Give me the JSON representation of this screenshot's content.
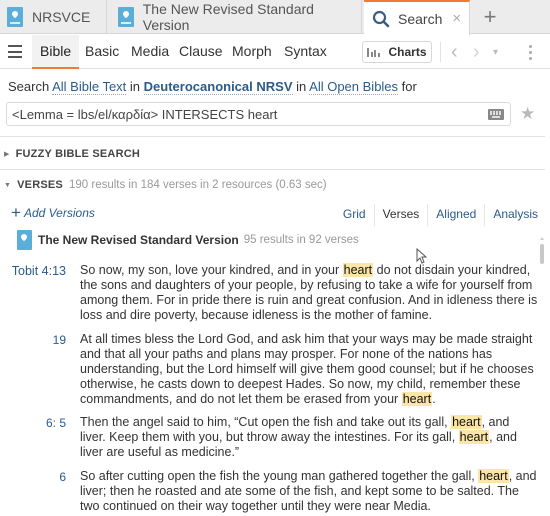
{
  "tabs": [
    {
      "label": "NRSVCE",
      "icon": "resource-book-icon"
    },
    {
      "label": "The New Revised Standard Version",
      "icon": "resource-book-icon"
    },
    {
      "label": "Search",
      "icon": "search-icon",
      "active": true,
      "close": "×"
    }
  ],
  "new_tab": "+",
  "toolbar": {
    "tabs": [
      "Bible",
      "Basic",
      "Media",
      "Clause",
      "Morph",
      "Syntax"
    ],
    "active_tab": "Bible",
    "charts_label": "Charts",
    "back": "‹",
    "forward": "›",
    "dropdown": "▾"
  },
  "search": {
    "prefix": "Search",
    "scope": "All Bible Text",
    "in1": "in",
    "collection": "Deuterocanonical NRSV",
    "in2": "in",
    "resources": "All Open Bibles",
    "for": "for",
    "query": "<Lemma = lbs/el/καρδία> INTERSECTS heart",
    "star": "★"
  },
  "sections": {
    "fuzzy": {
      "title": "FUZZY BIBLE SEARCH",
      "expanded": false
    },
    "verses": {
      "title": "VERSES",
      "meta": "190 results in 184 verses in 2 resources (0.63 sec)",
      "expanded": true
    }
  },
  "add_versions": "Add Versions",
  "view_tabs": [
    {
      "label": "Grid"
    },
    {
      "label": "Verses",
      "active": true
    },
    {
      "label": "Aligned"
    },
    {
      "label": "Analysis"
    }
  ],
  "resource": {
    "title": "The New Revised Standard Version",
    "meta": "95 results in 92 verses"
  },
  "highlight_color": "#fbe6a6",
  "accent_color": "#f07b35",
  "link_color": "#2a5b8c",
  "verses": [
    {
      "ref": "Tobit 4:13",
      "parts": [
        "So now, my son, love your kindred, and in your ",
        "heart",
        " do not disdain your kindred, the sons and daughters of your people, by refusing to take a wife for yourself from among them. For in pride there is ruin and great confusion. And in idleness there is loss and dire poverty, because idleness is the mother of famine."
      ]
    },
    {
      "ref": "19",
      "parts": [
        "At all times bless the Lord God, and ask him that your ways may be made straight and that all your paths and plans may prosper. For none of the nations has understanding, but the Lord himself will give them good counsel; but if he chooses otherwise, he casts down to deepest Hades. So now, my child, remember these commandments, and do not let them be erased from your ",
        "heart",
        "."
      ]
    },
    {
      "ref": "6: 5",
      "parts": [
        "Then the angel said to him, “Cut open the fish and take out its gall, ",
        "heart",
        ", and liver. Keep them with you, but throw away the intestines. For its gall, ",
        "heart",
        ", and liver are useful as medicine.”"
      ]
    },
    {
      "ref": "6",
      "parts": [
        "So after cutting open the fish the young man gathered together the gall, ",
        "heart",
        ", and liver; then he roasted and ate some of the fish, and kept some to be salted. The two continued on their way together until they were near Media."
      ]
    }
  ]
}
